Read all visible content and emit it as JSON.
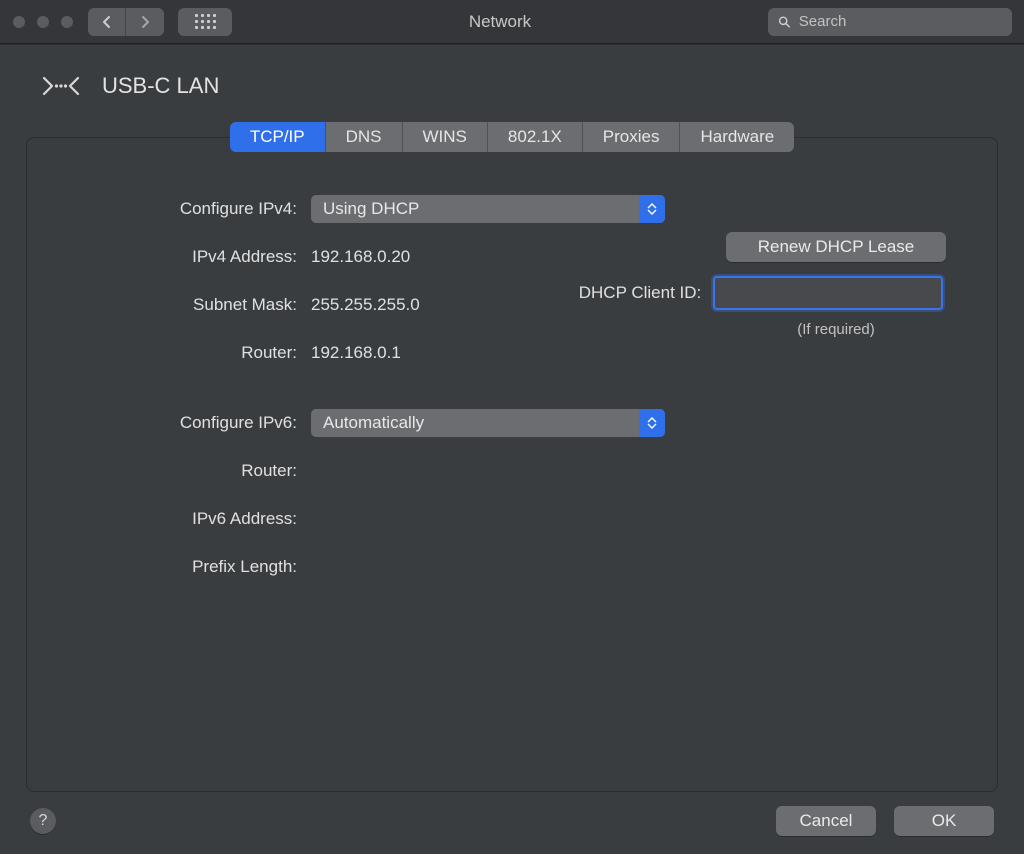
{
  "window": {
    "title": "Network",
    "search_placeholder": "Search"
  },
  "interface": {
    "name": "USB-C LAN"
  },
  "tabs": [
    {
      "id": "tcpip",
      "label": "TCP/IP",
      "active": true
    },
    {
      "id": "dns",
      "label": "DNS",
      "active": false
    },
    {
      "id": "wins",
      "label": "WINS",
      "active": false
    },
    {
      "id": "8021x",
      "label": "802.1X",
      "active": false
    },
    {
      "id": "proxies",
      "label": "Proxies",
      "active": false
    },
    {
      "id": "hardware",
      "label": "Hardware",
      "active": false
    }
  ],
  "ipv4": {
    "configure_label": "Configure IPv4:",
    "configure_value": "Using DHCP",
    "address_label": "IPv4 Address:",
    "address_value": "192.168.0.20",
    "subnet_label": "Subnet Mask:",
    "subnet_value": "255.255.255.0",
    "router_label": "Router:",
    "router_value": "192.168.0.1"
  },
  "dhcp": {
    "renew_label": "Renew DHCP Lease",
    "client_id_label": "DHCP Client ID:",
    "client_id_value": "",
    "hint": "(If required)"
  },
  "ipv6": {
    "configure_label": "Configure IPv6:",
    "configure_value": "Automatically",
    "router_label": "Router:",
    "router_value": "",
    "address_label": "IPv6 Address:",
    "address_value": "",
    "prefix_label": "Prefix Length:",
    "prefix_value": ""
  },
  "footer": {
    "help": "?",
    "cancel": "Cancel",
    "ok": "OK"
  }
}
